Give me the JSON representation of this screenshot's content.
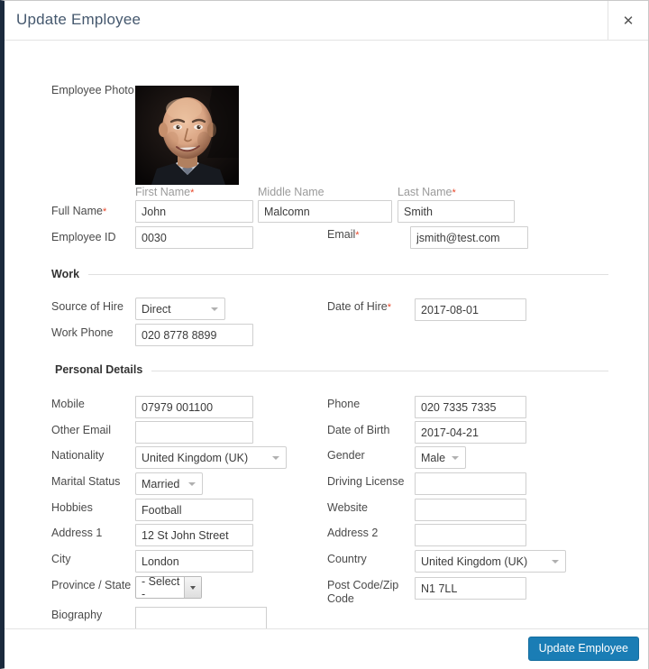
{
  "header": {
    "title": "Update Employee",
    "close_label": "✕"
  },
  "photo": {
    "label": "Employee Photo",
    "alt": "employee-portrait"
  },
  "identity": {
    "full_name_label": "Full Name",
    "full_name_required": "*",
    "first_name_label": "First Name",
    "first_name_required": "*",
    "first_name_value": "John",
    "middle_name_label": "Middle Name",
    "middle_name_value": "Malcomn",
    "last_name_label": "Last Name",
    "last_name_required": "*",
    "last_name_value": "Smith",
    "employee_id_label": "Employee ID",
    "employee_id_value": "0030",
    "email_label": "Email",
    "email_required": "*",
    "email_value": "jsmith@test.com"
  },
  "work": {
    "legend": "Work",
    "source_of_hire_label": "Source of Hire",
    "source_of_hire_value": "Direct",
    "date_of_hire_label": "Date of Hire",
    "date_of_hire_required": "*",
    "date_of_hire_value": "2017-08-01",
    "work_phone_label": "Work Phone",
    "work_phone_value": "020 8778 8899"
  },
  "personal": {
    "legend": "Personal Details",
    "mobile_label": "Mobile",
    "mobile_value": "07979 001100",
    "phone_label": "Phone",
    "phone_value": "020 7335 7335",
    "other_email_label": "Other Email",
    "other_email_value": "",
    "date_of_birth_label": "Date of Birth",
    "date_of_birth_value": "2017-04-21",
    "nationality_label": "Nationality",
    "nationality_value": "United Kingdom (UK)",
    "gender_label": "Gender",
    "gender_value": "Male",
    "marital_status_label": "Marital Status",
    "marital_status_value": "Married",
    "driving_license_label": "Driving License",
    "driving_license_value": "",
    "hobbies_label": "Hobbies",
    "hobbies_value": "Football",
    "website_label": "Website",
    "website_value": "",
    "address1_label": "Address 1",
    "address1_value": "12 St John Street",
    "address2_label": "Address 2",
    "address2_value": "",
    "city_label": "City",
    "city_value": "London",
    "country_label": "Country",
    "country_value": "United Kingdom (UK)",
    "province_label": "Province / State",
    "province_value": "- Select -",
    "postcode_label": "Post Code/Zip Code",
    "postcode_line1": "Post Code/Zip",
    "postcode_line2": "Code",
    "postcode_value": "N1 7LL",
    "biography_label": "Biography",
    "biography_value": ""
  },
  "footer": {
    "submit_label": "Update Employee"
  },
  "colors": {
    "accent": "#1a7db5",
    "title": "#45586e",
    "required": "#e8472a",
    "border": "#cfcfcf",
    "left_rail": "#1b2a3d"
  }
}
